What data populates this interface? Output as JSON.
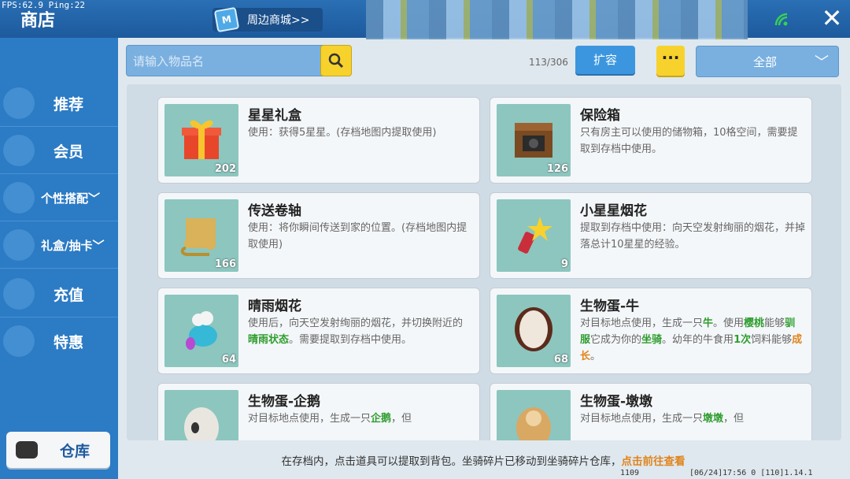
{
  "overlay": {
    "fps": "FPS:62.9  Ping:22"
  },
  "header": {
    "title": "商店",
    "mall_label": "周边商城>>"
  },
  "sidebar": {
    "items": [
      {
        "label": "推荐"
      },
      {
        "label": "会员"
      },
      {
        "label": "个性搭配"
      },
      {
        "label": "礼盒/抽卡"
      },
      {
        "label": "充值"
      },
      {
        "label": "特惠"
      }
    ],
    "warehouse_label": "仓库"
  },
  "toolbar": {
    "search_placeholder": "请输入物品名",
    "capacity": "113/306",
    "expand_label": "扩容",
    "more_label": "···",
    "filter_value": "全部"
  },
  "items": [
    {
      "name": "星星礼盒",
      "desc": "使用：获得5星星。(存档地图内提取使用)",
      "qty": "202"
    },
    {
      "name": "保险箱",
      "desc": "只有房主可以使用的储物箱，10格空间，需要提取到存档中使用。",
      "qty": "126"
    },
    {
      "name": "传送卷轴",
      "desc": "使用：将你瞬间传送到家的位置。(存档地图内提取使用)",
      "qty": "166"
    },
    {
      "name": "小星星烟花",
      "desc": "提取到存档中使用：向天空发射绚丽的烟花，并掉落总计10星星的经验。",
      "qty": "9"
    },
    {
      "name": "晴雨烟花",
      "desc_a": "使用后，向天空发射绚丽的烟花，并切换附近的",
      "desc_hl": "晴雨状态",
      "desc_b": "。需要提取到存档中使用。",
      "qty": "64"
    },
    {
      "name": "生物蛋-牛",
      "desc_1": "对目标地点使用，生成一只",
      "hl_1": "牛",
      "desc_2": "。使用",
      "hl_2": "樱桃",
      "desc_3": "能够",
      "hl_3": "驯服",
      "desc_4": "它成为你的",
      "hl_4": "坐骑",
      "desc_5": "。幼年的牛食用",
      "hl_5": "1次",
      "desc_6": "饲料能够",
      "hl_6": "成长",
      "desc_7": "。",
      "qty": "68"
    },
    {
      "name": "生物蛋-企鹅",
      "desc_1": "对目标地点使用，生成一只",
      "hl_1": "企鹅",
      "desc_2": "，但",
      "qty": ""
    },
    {
      "name": "生物蛋-墩墩",
      "desc_1": "对目标地点使用，生成一只",
      "hl_1": "墩墩",
      "desc_2": "，但",
      "qty": ""
    }
  ],
  "footer": {
    "tip": "在存档内，点击道具可以提取到背包。坐骑碎片已移动到坐骑碎片仓库，",
    "tip_link": "点击前往查看",
    "code": "1109",
    "info": "[06/24]17:56 0  [110]1.14.1"
  },
  "colors": {
    "accent_blue": "#2c7bc5",
    "yellow": "#f7d22c",
    "highlight_green": "#2e9d2e",
    "highlight_orange": "#e0841c",
    "thumb_bg": "#8cc6bf"
  }
}
